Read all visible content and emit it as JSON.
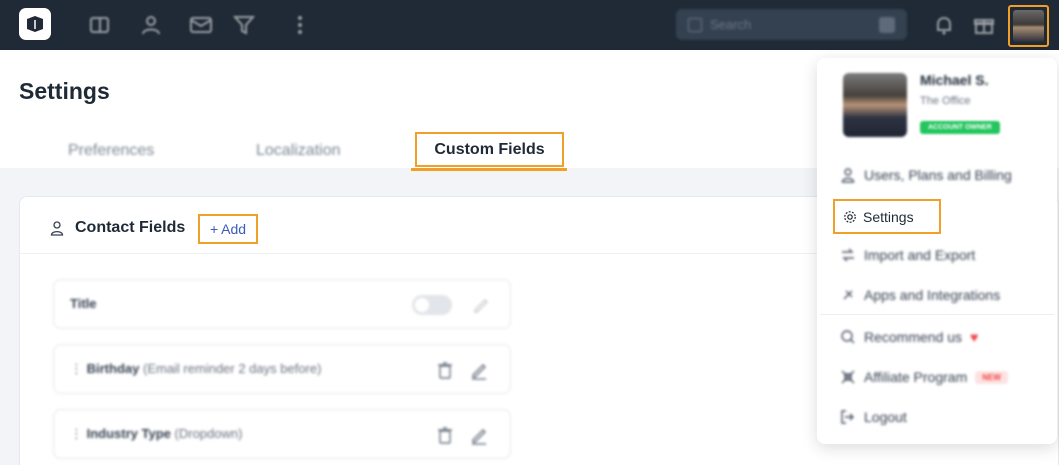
{
  "topnav": {
    "search_placeholder": "Search",
    "icons": [
      "logo-icon",
      "deals-icon",
      "contacts-icon",
      "mail-icon",
      "funnel-icon",
      "more-icon",
      "bell-icon",
      "gift-icon"
    ]
  },
  "page": {
    "title": "Settings",
    "tabs": [
      {
        "label": "Preferences"
      },
      {
        "label": "Localization"
      },
      {
        "label": "Custom Fields",
        "active": true
      }
    ]
  },
  "contact_fields": {
    "title": "Contact Fields",
    "add_label": "Add",
    "fields": [
      {
        "name": "Title",
        "detail": ""
      },
      {
        "name": "Birthday",
        "detail": "(Email reminder 2 days before)"
      },
      {
        "name": "Industry Type",
        "detail": "(Dropdown)"
      }
    ]
  },
  "profile_menu": {
    "name": "Michael S.",
    "org": "The Office",
    "badge": "ACCOUNT OWNER",
    "items": [
      {
        "label": "Users, Plans and Billing"
      },
      {
        "label": "Settings"
      },
      {
        "label": "Import and Export"
      },
      {
        "label": "Apps and Integrations"
      },
      {
        "label": "Recommend us"
      },
      {
        "label": "Affiliate Program",
        "badge": "NEW"
      },
      {
        "label": "Logout"
      }
    ]
  },
  "colors": {
    "nav_bg": "#1f2a36",
    "highlight": "#f0a028",
    "link": "#3b5bb7",
    "owner_badge": "#22c55e"
  }
}
